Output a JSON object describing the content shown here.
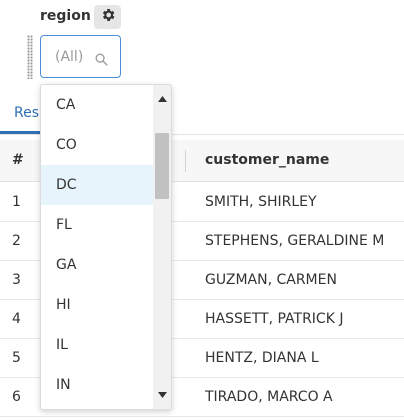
{
  "filter": {
    "label": "region",
    "icon": "gear-icon",
    "placeholder": "(All)",
    "search_icon": "search-icon"
  },
  "tab": {
    "label": "Res"
  },
  "table": {
    "columns": [
      "#",
      "customer_name"
    ],
    "rows": [
      {
        "num": "1",
        "name": "SMITH, SHIRLEY"
      },
      {
        "num": "2",
        "name": "STEPHENS, GERALDINE M"
      },
      {
        "num": "3",
        "name": "GUZMAN, CARMEN"
      },
      {
        "num": "4",
        "name": "HASSETT, PATRICK J"
      },
      {
        "num": "5",
        "name": "HENTZ, DIANA L"
      },
      {
        "num": "6",
        "name": "TIRADO, MARCO A"
      }
    ]
  },
  "dropdown": {
    "options": [
      "CA",
      "CO",
      "DC",
      "FL",
      "GA",
      "HI",
      "IL",
      "IN"
    ],
    "hovered": "DC"
  },
  "colors": {
    "accent": "#2f6fb5",
    "input_border": "#4a8fd8",
    "hover_bg": "#e8f4fb"
  }
}
